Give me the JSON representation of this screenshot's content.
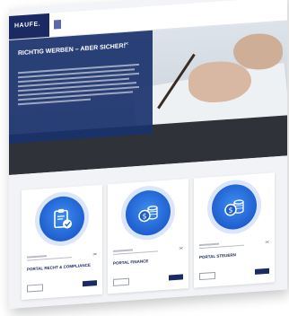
{
  "header": {
    "logo": "HAUFE.",
    "breadcrumb": "",
    "nav": [
      "",
      "",
      "",
      "",
      "",
      ""
    ]
  },
  "hero": {
    "title": "RICHTIG WERBEN – ABER SICHER!",
    "share_icon": "share-icon"
  },
  "cards": [
    {
      "title": "PORTAL RECHT & COMPLIANCE",
      "icon": "clipboard-check-icon"
    },
    {
      "title": "PORTAL FINANCE",
      "icon": "coins-dollar-icon"
    },
    {
      "title": "PORTAL STEUERN",
      "icon": "coins-dollar-icon"
    }
  ],
  "colors": {
    "brand": "#1b2a63",
    "accent": "#2b78e4",
    "hero_overlay": "#1a326c"
  }
}
